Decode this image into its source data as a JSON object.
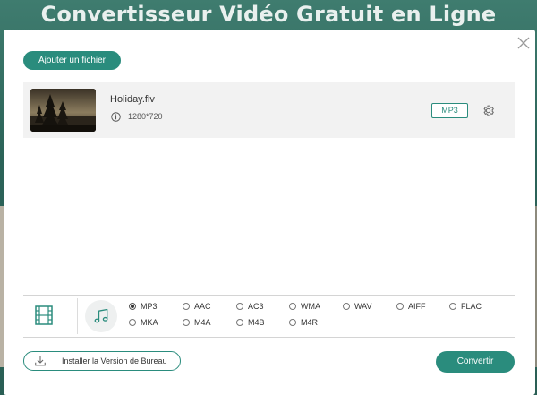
{
  "background": {
    "title": "Convertisseur Vidéo Gratuit en Ligne"
  },
  "dialog": {
    "add_file_label": "Ajouter un fichier",
    "file": {
      "name": "Holiday.flv",
      "resolution": "1280*720",
      "output_format": "MP3"
    },
    "formats": [
      {
        "label": "MP3",
        "selected": true
      },
      {
        "label": "AAC",
        "selected": false
      },
      {
        "label": "AC3",
        "selected": false
      },
      {
        "label": "WMA",
        "selected": false
      },
      {
        "label": "WAV",
        "selected": false
      },
      {
        "label": "AIFF",
        "selected": false
      },
      {
        "label": "FLAC",
        "selected": false
      },
      {
        "label": "MKA",
        "selected": false
      },
      {
        "label": "M4A",
        "selected": false
      },
      {
        "label": "M4B",
        "selected": false
      },
      {
        "label": "M4R",
        "selected": false
      }
    ],
    "install_label": "Installer la Version de Bureau",
    "convert_label": "Convertir"
  },
  "colors": {
    "accent": "#2a8c7d"
  },
  "icons": {
    "close": "close-icon",
    "info": "info-icon",
    "settings": "gear-icon",
    "video_tab": "film-icon",
    "audio_tab": "music-note-icon",
    "download": "download-icon"
  }
}
